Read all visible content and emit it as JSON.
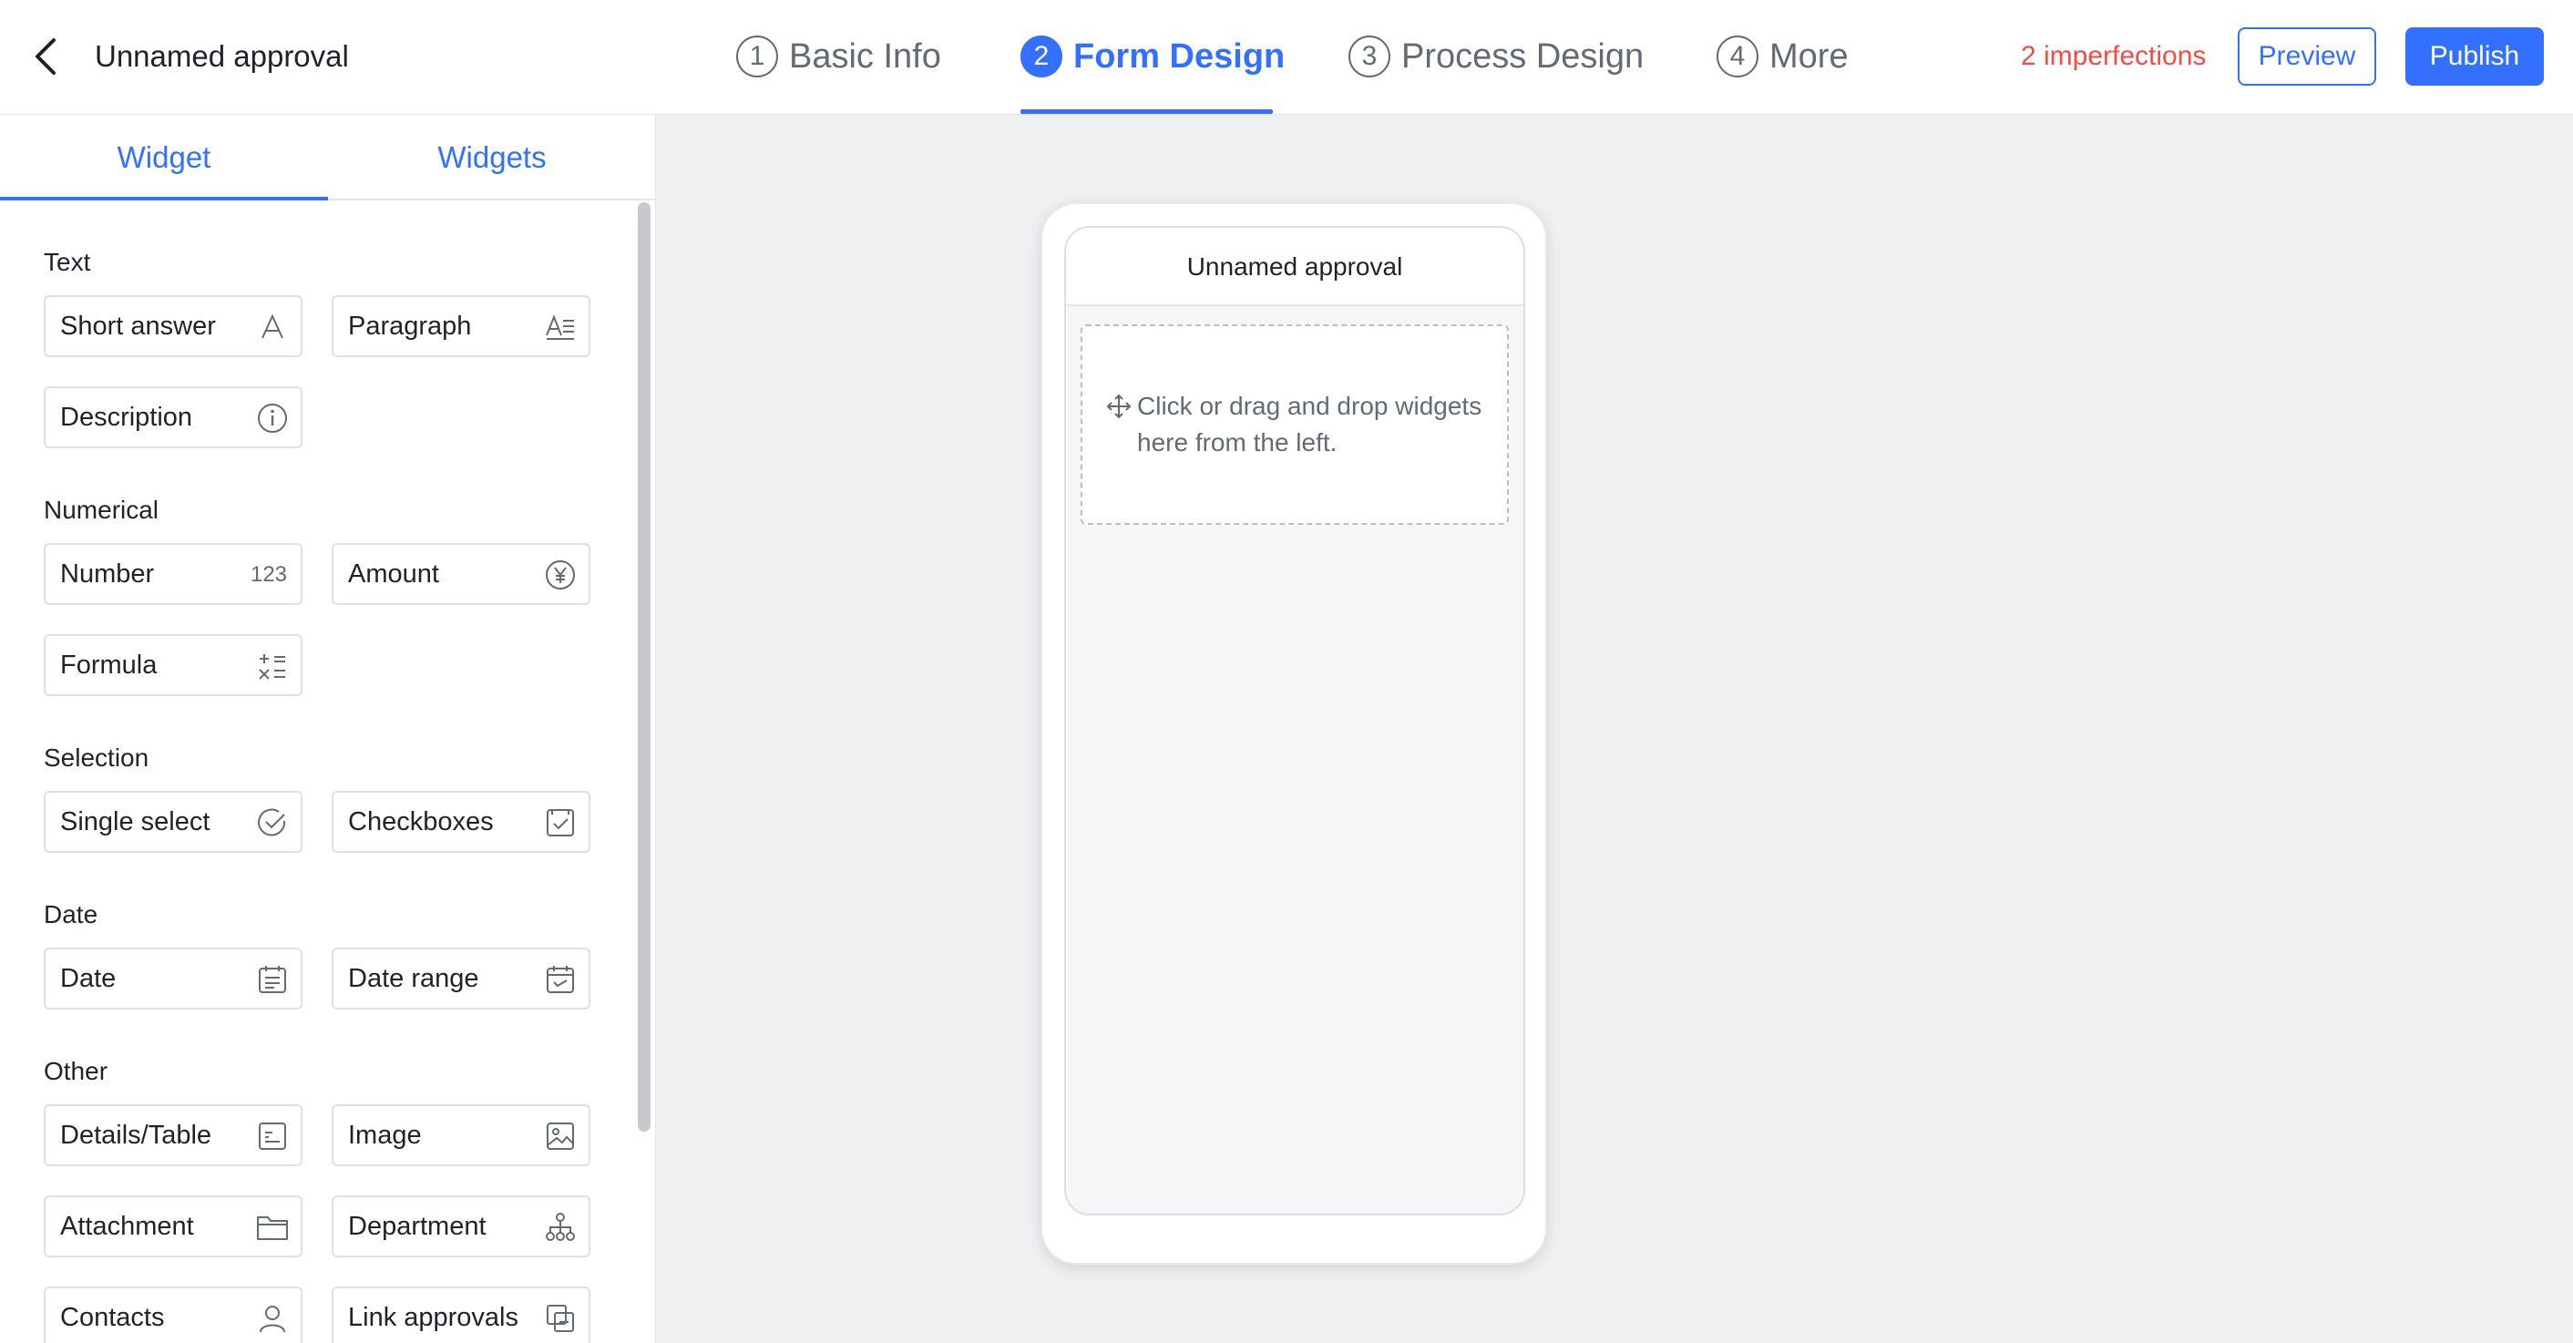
{
  "header": {
    "title": "Unnamed approval",
    "steps": [
      {
        "num": "1",
        "label": "Basic Info"
      },
      {
        "num": "2",
        "label": "Form Design"
      },
      {
        "num": "3",
        "label": "Process Design"
      },
      {
        "num": "4",
        "label": "More"
      }
    ],
    "active_step": 2,
    "imperfections": "2 imperfections",
    "preview_label": "Preview",
    "publish_label": "Publish"
  },
  "sidebar": {
    "tabs": [
      "Widget",
      "Widgets"
    ],
    "groups": [
      {
        "title": "Text",
        "items": [
          {
            "label": "Short answer",
            "icon": "text-a-icon"
          },
          {
            "label": "Paragraph",
            "icon": "paragraph-icon"
          },
          {
            "label": "Description",
            "icon": "info-icon"
          }
        ]
      },
      {
        "title": "Numerical",
        "items": [
          {
            "label": "Number",
            "icon": "number-icon",
            "icon_text": "123"
          },
          {
            "label": "Amount",
            "icon": "yen-icon"
          },
          {
            "label": "Formula",
            "icon": "formula-icon"
          }
        ]
      },
      {
        "title": "Selection",
        "items": [
          {
            "label": "Single select",
            "icon": "check-circle-icon"
          },
          {
            "label": "Checkboxes",
            "icon": "checkbox-icon"
          }
        ]
      },
      {
        "title": "Date",
        "items": [
          {
            "label": "Date",
            "icon": "calendar-icon"
          },
          {
            "label": "Date range",
            "icon": "date-range-icon"
          }
        ]
      },
      {
        "title": "Other",
        "items": [
          {
            "label": "Details/Table",
            "icon": "table-icon"
          },
          {
            "label": "Image",
            "icon": "image-icon"
          },
          {
            "label": "Attachment",
            "icon": "folder-icon"
          },
          {
            "label": "Department",
            "icon": "org-chart-icon"
          },
          {
            "label": "Contacts",
            "icon": "person-icon"
          },
          {
            "label": "Link approvals",
            "icon": "link-approval-icon"
          }
        ]
      }
    ]
  },
  "canvas": {
    "form_title": "Unnamed approval",
    "drop_hint": "Click or drag and drop widgets here from the left."
  },
  "colors": {
    "accent": "#3370ff",
    "warning": "#f54a45",
    "canvas_bg": "#eff0f2"
  }
}
